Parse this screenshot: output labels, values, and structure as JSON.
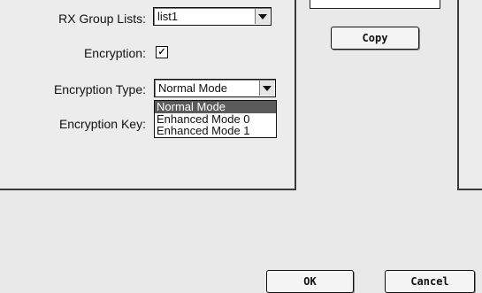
{
  "form": {
    "rx_group_lists_label": "RX Group Lists:",
    "rx_group_lists_value": "list1",
    "encryption_label": "Encryption:",
    "encryption_checked": true,
    "encryption_check_glyph": "☑",
    "encryption_type_label": "Encryption Type:",
    "encryption_type_value": "Normal Mode",
    "encryption_type_options": [
      "Normal Mode",
      "Enhanced Mode 0",
      "Enhanced Mode 1"
    ],
    "encryption_key_label": "Encryption Key:"
  },
  "buttons": {
    "copy": "Copy",
    "ok": "OK",
    "cancel": "Cancel"
  },
  "icons": {
    "dropdown_arrow": "chevron-down-icon",
    "checkbox": "checkmark-icon"
  }
}
